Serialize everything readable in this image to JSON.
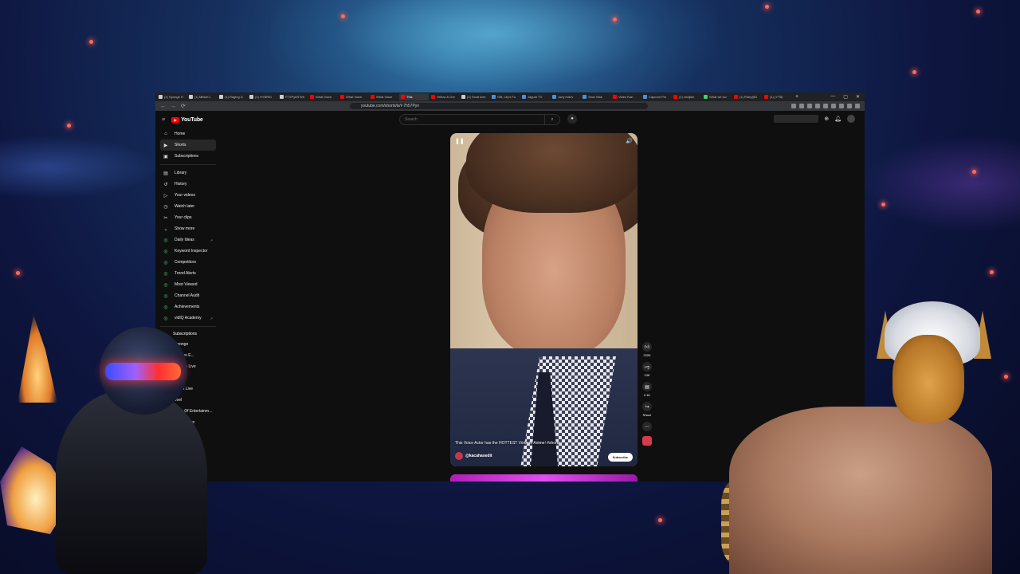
{
  "browser": {
    "tabs": [
      {
        "label": "(1) Sponge H",
        "icon_color": "#cccccc"
      },
      {
        "label": "(1) Mikkel L",
        "icon_color": "#cccccc"
      },
      {
        "label": "(1) Raging G",
        "icon_color": "#cccccc"
      },
      {
        "label": "(1) HYBRID",
        "icon_color": "#cccccc"
      },
      {
        "label": "FTXPyMTWh",
        "icon_color": "#cccccc"
      },
      {
        "label": "What Voice",
        "icon_color": "#ff0000"
      },
      {
        "label": "What Voice",
        "icon_color": "#ff0000"
      },
      {
        "label": "What Voice",
        "icon_color": "#ff0000"
      },
      {
        "label": "This",
        "icon_color": "#ff0000",
        "active": true
      },
      {
        "label": "Yellow & Gre",
        "icon_color": "#ff0000"
      },
      {
        "label": "(2) Scott Arm",
        "icon_color": "#cccccc"
      },
      {
        "label": "Gift, Lily's Fu",
        "icon_color": "#4a90d9"
      },
      {
        "label": "Jaguar TV",
        "icon_color": "#4a90d9"
      },
      {
        "label": "Joey interv",
        "icon_color": "#4a90d9"
      },
      {
        "label": "Xbox Mak",
        "icon_color": "#4a90d9"
      },
      {
        "label": "Video Kari",
        "icon_color": "#ff0000"
      },
      {
        "label": "Capcom Pre",
        "icon_color": "#4a90d9"
      },
      {
        "label": "(1) chuijkin",
        "icon_color": "#ff0000"
      },
      {
        "label": "What we luv",
        "icon_color": "#3ecf6e"
      },
      {
        "label": "(1) Ruby@D",
        "icon_color": "#ff0000"
      },
      {
        "label": "(1) (YTB)",
        "icon_color": "#ff0000"
      }
    ],
    "new_tab_symbol": "+",
    "window_controls": [
      "—",
      "▢",
      "✕"
    ],
    "url": "youtube.com/shorts/iaY-7h57Pyn",
    "nav": {
      "back": "←",
      "forward": "→",
      "reload": "⟳"
    }
  },
  "youtube": {
    "logo_text": "YouTube",
    "search_placeholder": "Search",
    "sidebar": [
      {
        "label": "Home",
        "icon": "⌂",
        "name": "home"
      },
      {
        "label": "Shorts",
        "icon": "▶",
        "name": "shorts",
        "active": true
      },
      {
        "label": "Subscriptions",
        "icon": "▣",
        "name": "subscriptions"
      }
    ],
    "sidebar2": [
      {
        "label": "Library",
        "icon": "▤",
        "name": "library"
      },
      {
        "label": "History",
        "icon": "↺",
        "name": "history"
      },
      {
        "label": "Your videos",
        "icon": "▷",
        "name": "your-videos"
      },
      {
        "label": "Watch later",
        "icon": "◷",
        "name": "watch-later"
      },
      {
        "label": "Your clips",
        "icon": "✂",
        "name": "your-clips"
      },
      {
        "label": "Show more",
        "icon": "⌄",
        "name": "show-more"
      }
    ],
    "vidiq": [
      {
        "label": "Daily Ideas",
        "name": "daily-ideas",
        "ext": "↗"
      },
      {
        "label": "Keyword Inspector",
        "name": "keyword-inspector",
        "ext": ""
      },
      {
        "label": "Competitors",
        "name": "competitors",
        "ext": ""
      },
      {
        "label": "Trend Alerts",
        "name": "trend-alerts",
        "ext": ""
      },
      {
        "label": "Most Viewed",
        "name": "most-viewed",
        "ext": ""
      },
      {
        "label": "Channel Audit",
        "name": "channel-audit",
        "ext": ""
      },
      {
        "label": "Achievements",
        "name": "achievements",
        "ext": ""
      },
      {
        "label": "vidIQ Academy",
        "name": "vidiq-academy",
        "ext": "↗"
      }
    ],
    "subscriptions_heading": "Subscriptions",
    "subscriptions": [
      {
        "label": "Sponge",
        "name": "sub-sponge"
      },
      {
        "label": "Hidden E...",
        "name": "sub-hidden"
      },
      {
        "label": "MeTwo Live",
        "name": "sub-metwo"
      },
      {
        "label": "Coast",
        "name": "sub-coast"
      },
      {
        "label": "SkillX Live",
        "name": "sub-skillx"
      },
      {
        "label": "Joel",
        "name": "sub-joel"
      },
      {
        "label": "Look Of Entertainm...",
        "name": "sub-look"
      },
      {
        "label": "Show more",
        "name": "sub-show-more"
      }
    ]
  },
  "short": {
    "caption": "This Voice Actor has the HOTTEST Voice in Anime! #shorts",
    "channel": "@kacahasedit",
    "subscribe_label": "Subscribe",
    "play_icon": "❚❚",
    "volume_icon": "🔊",
    "likes": "232K",
    "dislike_label": "13K",
    "comments": "2.1K",
    "share_label": "Share",
    "more_icon": "⋯"
  }
}
